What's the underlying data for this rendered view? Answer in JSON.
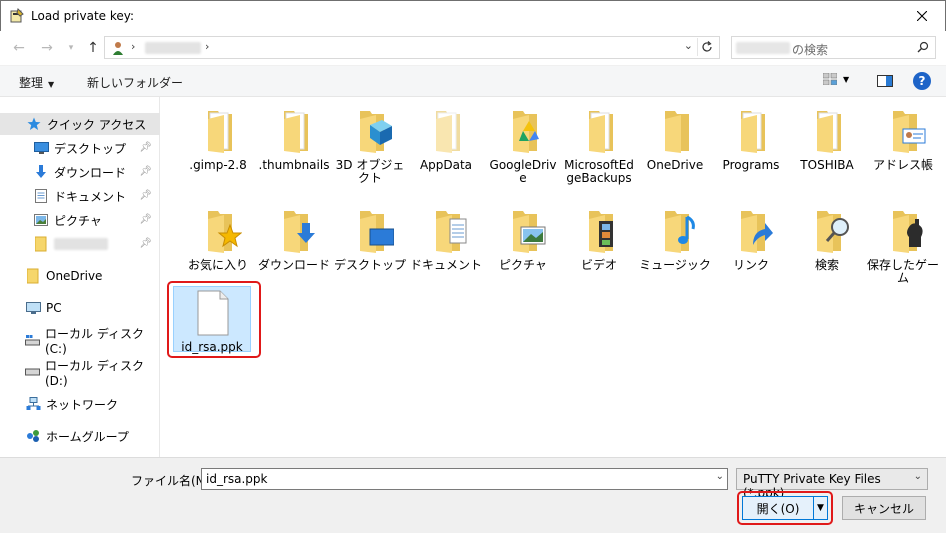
{
  "window": {
    "title": "Load private key:"
  },
  "address": {
    "search_placeholder": "の検索"
  },
  "toolbar": {
    "organize": "整理",
    "new_folder": "新しいフォルダー"
  },
  "sidebar": {
    "items": [
      {
        "label": "クイック アクセス"
      },
      {
        "label": "デスクトップ"
      },
      {
        "label": "ダウンロード"
      },
      {
        "label": "ドキュメント"
      },
      {
        "label": "ピクチャ"
      },
      {
        "label": ""
      },
      {
        "label": "OneDrive"
      },
      {
        "label": "PC"
      },
      {
        "label": "ローカル ディスク (C:)"
      },
      {
        "label": "ローカル ディスク (D:)"
      },
      {
        "label": "ネットワーク"
      },
      {
        "label": "ホームグループ"
      }
    ]
  },
  "files": {
    "row1": [
      {
        "label": ".gimp-2.8"
      },
      {
        "label": ".thumbnails"
      },
      {
        "label": "3D オブジェクト"
      },
      {
        "label": "AppData"
      },
      {
        "label": "GoogleDrive"
      },
      {
        "label": "MicrosoftEdgeBackups"
      },
      {
        "label": "OneDrive"
      },
      {
        "label": "Programs"
      },
      {
        "label": "TOSHIBA"
      },
      {
        "label": "アドレス帳"
      }
    ],
    "row2": [
      {
        "label": "お気に入り"
      },
      {
        "label": "ダウンロード"
      },
      {
        "label": "デスクトップ"
      },
      {
        "label": "ドキュメント"
      },
      {
        "label": "ピクチャ"
      },
      {
        "label": "ビデオ"
      },
      {
        "label": "ミュージック"
      },
      {
        "label": "リンク"
      },
      {
        "label": "検索"
      },
      {
        "label": "保存したゲーム"
      }
    ],
    "selected_file": {
      "label": "id_rsa.ppk"
    }
  },
  "footer": {
    "filename_label": "ファイル名(N):",
    "filename_value": "id_rsa.ppk",
    "filter_value": "PuTTY Private Key Files (*.ppk)",
    "open_label": "開く(O)",
    "cancel_label": "キャンセル"
  }
}
